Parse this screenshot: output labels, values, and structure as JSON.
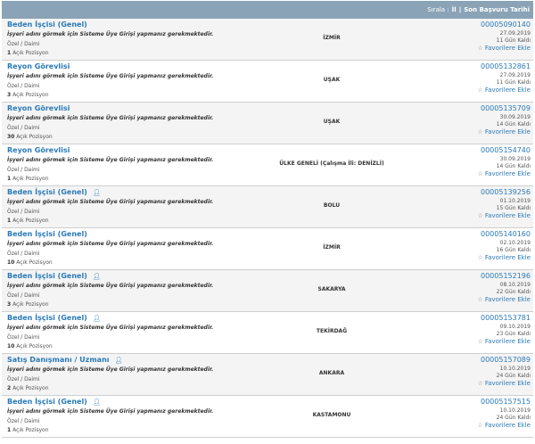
{
  "sort": {
    "label": "Sırala :",
    "il": "İl",
    "separator": "|",
    "son_basvuru": "Son Başvuru Tarihi"
  },
  "common": {
    "warning": "İşyeri adını görmek için Sisteme Üye Girişi yapmanız gerekmektedir.",
    "type": "Özel / Daimi",
    "position_suffix": "Açık Pozisyon",
    "favorite": "Favorilere Ekle",
    "icon": "user-icon"
  },
  "jobs": [
    {
      "title": "Beden İşçisi (Genel)",
      "icon": false,
      "count": "1",
      "city": "İZMİR",
      "no": "00005090140",
      "date": "27.09.2019",
      "remaining": "11 Gün Kaldı"
    },
    {
      "title": "Reyon Görevlisi",
      "icon": false,
      "count": "3",
      "city": "UŞAK",
      "no": "00005132861",
      "date": "27.09.2019",
      "remaining": "11 Gün Kaldı"
    },
    {
      "title": "Reyon Görevlisi",
      "icon": false,
      "count": "30",
      "city": "UŞAK",
      "no": "00005135709",
      "date": "30.09.2019",
      "remaining": "14 Gün Kaldı"
    },
    {
      "title": "Reyon Görevlisi",
      "icon": false,
      "count": "1",
      "city": "ÜLKE GENELİ (Çalışma İli: DENİZLİ)",
      "no": "00005154740",
      "date": "30.09.2019",
      "remaining": "14 Gün Kaldı"
    },
    {
      "title": "Beden İşçisi (Genel)",
      "icon": true,
      "count": "1",
      "city": "BOLU",
      "no": "00005139256",
      "date": "01.10.2019",
      "remaining": "15 Gün Kaldı"
    },
    {
      "title": "Beden İşçisi (Genel)",
      "icon": false,
      "count": "10",
      "city": "İZMİR",
      "no": "00005140160",
      "date": "02.10.2019",
      "remaining": "16 Gün Kaldı"
    },
    {
      "title": "Beden İşçisi (Genel)",
      "icon": true,
      "count": "3",
      "city": "SAKARYA",
      "no": "00005152196",
      "date": "08.10.2019",
      "remaining": "22 Gün Kaldı"
    },
    {
      "title": "Beden İşçisi (Genel)",
      "icon": true,
      "count": "10",
      "city": "TEKİRDAĞ",
      "no": "00005153781",
      "date": "09.10.2019",
      "remaining": "23 Gün Kaldı"
    },
    {
      "title": "Satış Danışmanı / Uzmanı",
      "icon": true,
      "count": "2",
      "city": "ANKARA",
      "no": "00005157089",
      "date": "10.10.2019",
      "remaining": "24 Gün Kaldı"
    },
    {
      "title": "Beden İşçisi (Genel)",
      "icon": true,
      "count": "1",
      "city": "KASTAMONU",
      "no": "00005157515",
      "date": "10.10.2019",
      "remaining": "24 Gün Kaldı"
    }
  ]
}
